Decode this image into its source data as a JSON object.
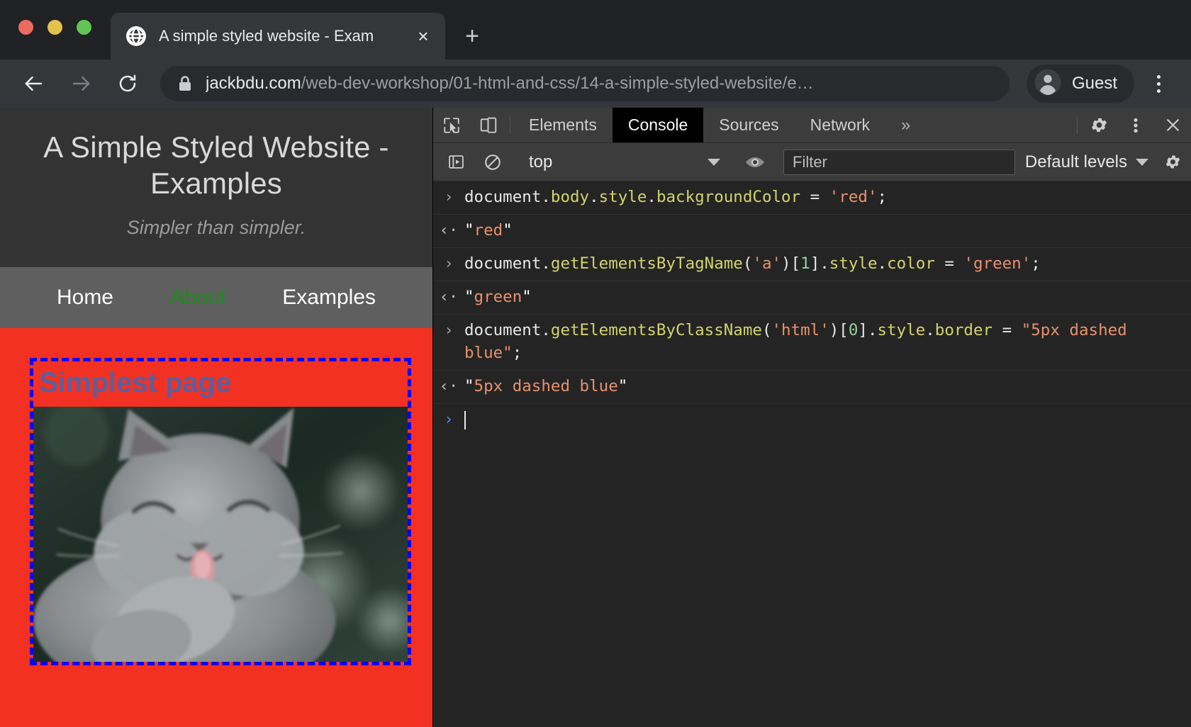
{
  "browser": {
    "tab": {
      "title": "A simple styled website - Exam",
      "favicon": "globe-icon",
      "close": "×"
    },
    "newtab_label": "+",
    "nav": {
      "back": "back-arrow-icon",
      "forward": "forward-arrow-icon",
      "reload": "reload-icon"
    },
    "omnibox": {
      "lock": "lock-icon",
      "host": "jackbdu.com",
      "path": "/web-dev-workshop/01-html-and-css/14-a-simple-styled-website/e…",
      "full_url": "jackbdu.com/web-dev-workshop/01-html-and-css/14-a-simple-styled-website/e…"
    },
    "profile": {
      "label": "Guest",
      "avatar": "person-icon"
    },
    "menu": "three-dot-menu-icon"
  },
  "page": {
    "title": "A Simple Styled Website - Examples",
    "tagline": "Simpler than simpler.",
    "nav": [
      {
        "label": "Home",
        "color": "#ffffff"
      },
      {
        "label": "About",
        "color": "#1a8d1a"
      },
      {
        "label": "Examples",
        "color": "#ffffff"
      }
    ],
    "heading": "Simplest page",
    "image_alt": "grey cat licking its paw",
    "body_background": "#f23122",
    "html_border": "5px dashed blue",
    "heading_color": "#5c5f9e"
  },
  "devtools": {
    "tabs": [
      {
        "label": "Elements",
        "active": false
      },
      {
        "label": "Console",
        "active": true
      },
      {
        "label": "Sources",
        "active": false
      },
      {
        "label": "Network",
        "active": false
      }
    ],
    "more_label": "»",
    "icons": {
      "inspect": "inspect-element-icon",
      "device": "device-toolbar-icon",
      "settings": "gear-icon",
      "menu": "three-dot-menu-icon",
      "close": "close-icon"
    },
    "filterbar": {
      "execute_icon": "console-sidebar-icon",
      "clear_icon": "clear-console-icon",
      "context": "top",
      "eye_icon": "live-expression-icon",
      "filter_placeholder": "Filter",
      "filter_value": "",
      "levels": "Default levels",
      "settings_icon": "gear-icon"
    },
    "console_rows": [
      {
        "kind": "cmd",
        "gutter": "›",
        "tokens": [
          {
            "t": "document",
            "c": "t-plain"
          },
          {
            "t": ".",
            "c": "t-punct"
          },
          {
            "t": "body",
            "c": "t-prop"
          },
          {
            "t": ".",
            "c": "t-punct"
          },
          {
            "t": "style",
            "c": "t-prop"
          },
          {
            "t": ".",
            "c": "t-punct"
          },
          {
            "t": "backgroundColor",
            "c": "t-prop"
          },
          {
            "t": " = ",
            "c": "t-punct"
          },
          {
            "t": "'red'",
            "c": "t-str"
          },
          {
            "t": ";",
            "c": "t-punct"
          }
        ]
      },
      {
        "kind": "ret",
        "gutter": "‹·",
        "tokens": [
          {
            "t": "\"",
            "c": "t-quote"
          },
          {
            "t": "red",
            "c": "t-str"
          },
          {
            "t": "\"",
            "c": "t-quote"
          }
        ]
      },
      {
        "kind": "cmd",
        "gutter": "›",
        "tokens": [
          {
            "t": "document",
            "c": "t-plain"
          },
          {
            "t": ".",
            "c": "t-punct"
          },
          {
            "t": "getElementsByTagName",
            "c": "t-fn"
          },
          {
            "t": "(",
            "c": "t-punct"
          },
          {
            "t": "'a'",
            "c": "t-str"
          },
          {
            "t": ")[",
            "c": "t-punct"
          },
          {
            "t": "1",
            "c": "t-num"
          },
          {
            "t": "]",
            "c": "t-punct"
          },
          {
            "t": ".",
            "c": "t-punct"
          },
          {
            "t": "style",
            "c": "t-prop"
          },
          {
            "t": ".",
            "c": "t-punct"
          },
          {
            "t": "color",
            "c": "t-prop"
          },
          {
            "t": " = ",
            "c": "t-punct"
          },
          {
            "t": "'green'",
            "c": "t-str"
          },
          {
            "t": ";",
            "c": "t-punct"
          }
        ]
      },
      {
        "kind": "ret",
        "gutter": "‹·",
        "tokens": [
          {
            "t": "\"",
            "c": "t-quote"
          },
          {
            "t": "green",
            "c": "t-str"
          },
          {
            "t": "\"",
            "c": "t-quote"
          }
        ]
      },
      {
        "kind": "cmd",
        "gutter": "›",
        "tokens": [
          {
            "t": "document",
            "c": "t-plain"
          },
          {
            "t": ".",
            "c": "t-punct"
          },
          {
            "t": "getElementsByClassName",
            "c": "t-fn"
          },
          {
            "t": "(",
            "c": "t-punct"
          },
          {
            "t": "'html'",
            "c": "t-str"
          },
          {
            "t": ")[",
            "c": "t-punct"
          },
          {
            "t": "0",
            "c": "t-num"
          },
          {
            "t": "]",
            "c": "t-punct"
          },
          {
            "t": ".",
            "c": "t-punct"
          },
          {
            "t": "style",
            "c": "t-prop"
          },
          {
            "t": ".",
            "c": "t-punct"
          },
          {
            "t": "border",
            "c": "t-prop"
          },
          {
            "t": " = ",
            "c": "t-punct"
          },
          {
            "t": "\"5px dashed blue\"",
            "c": "t-str"
          },
          {
            "t": ";",
            "c": "t-punct"
          }
        ]
      },
      {
        "kind": "ret",
        "gutter": "‹·",
        "tokens": [
          {
            "t": "\"",
            "c": "t-quote"
          },
          {
            "t": "5px dashed blue",
            "c": "t-str"
          },
          {
            "t": "\"",
            "c": "t-quote"
          }
        ]
      }
    ],
    "prompt": {
      "gutter": "›",
      "value": ""
    }
  }
}
